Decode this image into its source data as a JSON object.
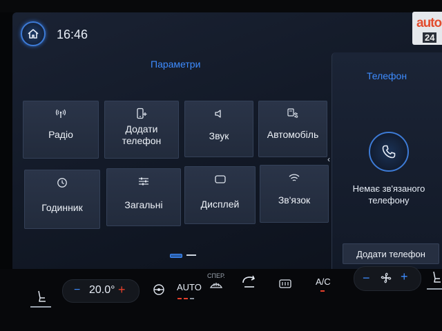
{
  "header": {
    "time": "16:46"
  },
  "settings": {
    "title": "Параметри",
    "tiles": [
      {
        "label": "Радіо",
        "icon": "radio-antenna-icon"
      },
      {
        "label": "Додати\nтелефон",
        "icon": "add-phone-icon"
      },
      {
        "label": "Звук",
        "icon": "speaker-icon"
      },
      {
        "label": "Автомобіль",
        "icon": "car-settings-icon"
      },
      {
        "label": "Годинник",
        "icon": "clock-icon"
      },
      {
        "label": "Загальні",
        "icon": "sliders-icon"
      },
      {
        "label": "Дисплей",
        "icon": "display-icon"
      },
      {
        "label": "Зв'язок",
        "icon": "wifi-icon"
      }
    ]
  },
  "phone": {
    "title": "Телефон",
    "message": "Немає зв'язаного телефону",
    "add_button": "Додати телефон"
  },
  "climate": {
    "temperature": "20.0°",
    "minus": "−",
    "plus": "+",
    "auto_label": "AUTO",
    "sper_label": "СПЕР.",
    "ac_label": "A/C"
  },
  "watermark": {
    "brand": "auto",
    "sub": "24"
  },
  "colors": {
    "accent": "#3e8cff",
    "warn": "#e8402b",
    "tile": "#262f41"
  }
}
